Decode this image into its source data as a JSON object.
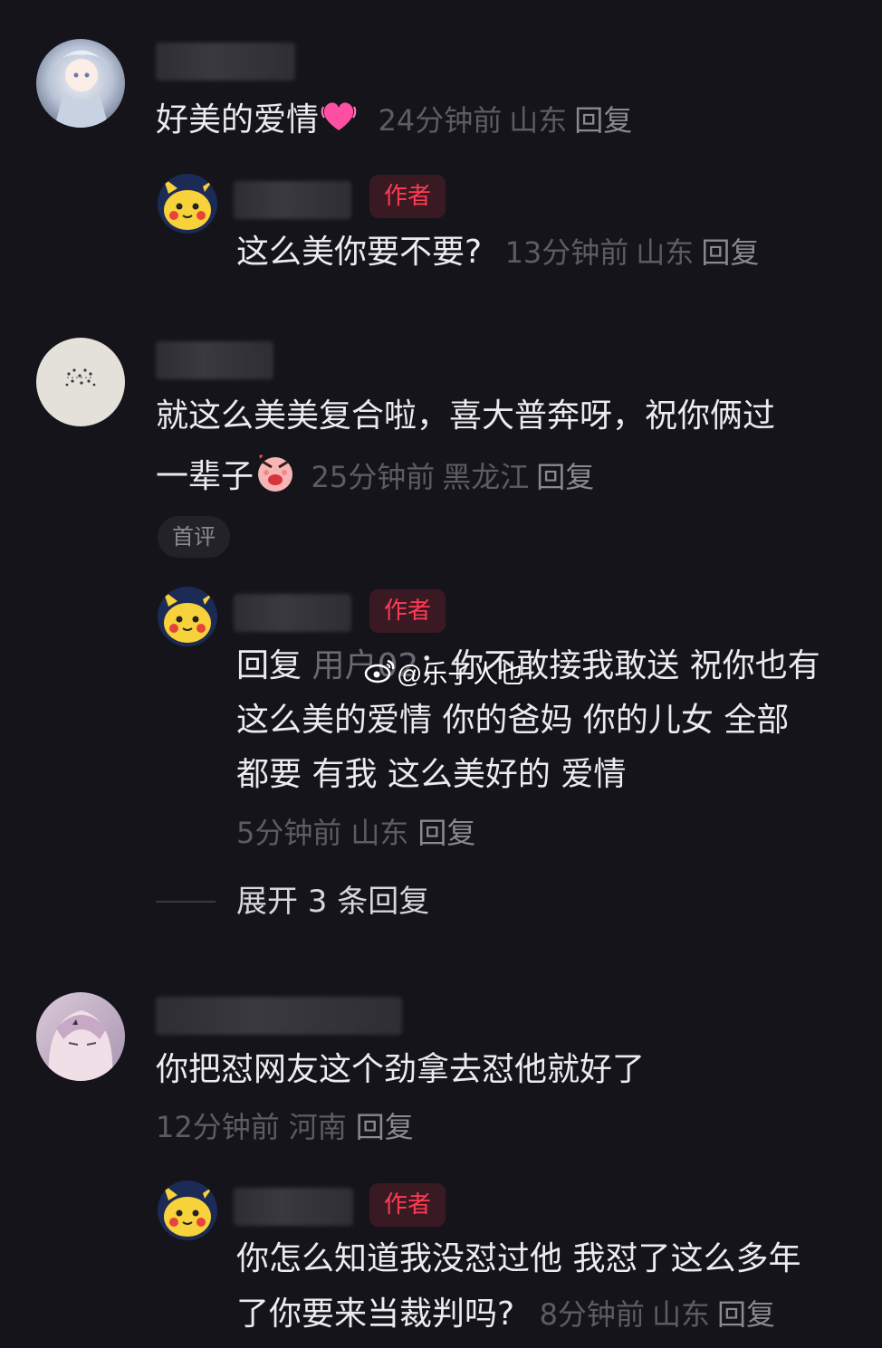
{
  "author_tag": "作者",
  "comments": [
    {
      "text": "好美的爱情",
      "emoji": "pink-heart-icon",
      "time": "24分钟前",
      "location": "山东",
      "reply": "回复",
      "replies": [
        {
          "text": "这么美你要不要?",
          "time": "13分钟前",
          "location": "山东",
          "reply": "回复"
        }
      ]
    },
    {
      "text_line1": "就这么美美复合啦，喜大普奔呀，祝你俩过",
      "text_line2": "一辈子",
      "emoji": "angry-face-icon",
      "time": "25分钟前",
      "location": "黑龙江",
      "reply": "回复",
      "badge": "首评",
      "replies": [
        {
          "prefix": "回复",
          "mention": "用户02",
          "line1": "：你不敢接我敢送 祝你也有",
          "line2": "这么美的爱情 你的爸妈 你的儿女 全部",
          "line3": "都要 有我 这么美好的 爱情",
          "time": "5分钟前",
          "location": "山东",
          "reply": "回复"
        }
      ],
      "expand": "展开 3 条回复"
    },
    {
      "text": "你把怼网友这个劲拿去怼他就好了",
      "time": "12分钟前",
      "location": "河南",
      "reply": "回复",
      "replies": [
        {
          "line1": "你怎么知道我没怼过他 我怼了这么多年",
          "line2": "了你要来当裁判吗?",
          "time": "8分钟前",
          "location": "山东",
          "reply": "回复"
        }
      ]
    }
  ],
  "watermark": "@乐子人也"
}
